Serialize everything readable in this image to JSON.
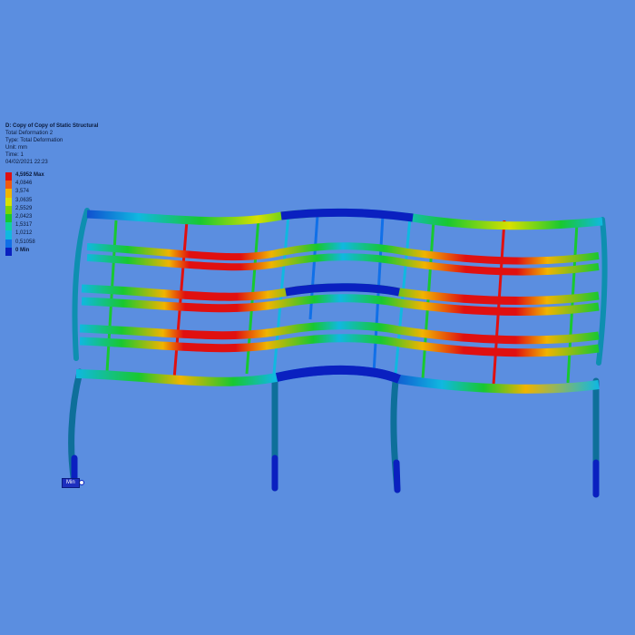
{
  "result_info": {
    "title": "D: Copy of Copy of Static Structural",
    "result_name": "Total Deformation 2",
    "type": "Type: Total Deformation",
    "unit": "Unit: mm",
    "time": "Time: 1",
    "date": "04/02/2021 22:23"
  },
  "legend": {
    "entries": [
      {
        "label": "4,5952 Max",
        "color": "#e01010",
        "bold": true
      },
      {
        "label": "4,0846",
        "color": "#f05a10",
        "bold": false
      },
      {
        "label": "3,574",
        "color": "#f0b400",
        "bold": false
      },
      {
        "label": "3,0635",
        "color": "#d8e000",
        "bold": false
      },
      {
        "label": "2,5529",
        "color": "#7ad400",
        "bold": false
      },
      {
        "label": "2,0423",
        "color": "#18c830",
        "bold": false
      },
      {
        "label": "1,5317",
        "color": "#10d0a0",
        "bold": false
      },
      {
        "label": "1,0212",
        "color": "#10b8e0",
        "bold": false
      },
      {
        "label": "0,51058",
        "color": "#1070e8",
        "bold": false
      },
      {
        "label": "0 Min",
        "color": "#0a20c0",
        "bold": true
      }
    ]
  },
  "min_probe": {
    "label": "Min"
  }
}
